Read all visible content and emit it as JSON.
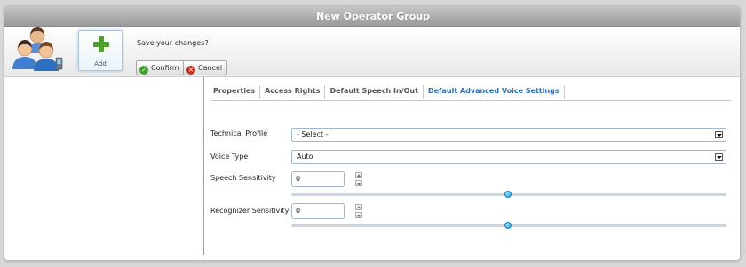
{
  "window": {
    "title": "New Operator Group"
  },
  "toolbar": {
    "group_icon": "user-group-icon",
    "add_label": "Add",
    "add_icon": "plus-icon",
    "prompt": "Save your changes?",
    "confirm_label": "Confirm",
    "confirm_icon": "check-icon",
    "cancel_label": "Cancel",
    "cancel_icon": "close-icon"
  },
  "tabs": [
    {
      "label": "Properties",
      "active": false
    },
    {
      "label": "Access Rights",
      "active": false
    },
    {
      "label": "Default Speech In/Out",
      "active": false
    },
    {
      "label": "Default Advanced Voice Settings",
      "active": true
    }
  ],
  "form": {
    "technical_profile": {
      "label": "Technical Profile",
      "value": "- Select -"
    },
    "voice_type": {
      "label": "Voice Type",
      "value": "Auto"
    },
    "speech_sensitivity": {
      "label": "Speech Sensitivity",
      "value": "0",
      "slider_level": 0.5
    },
    "recognizer_sensitivity": {
      "label": "Recognizer Sensitivity",
      "value": "0",
      "slider_level": 0.5
    }
  },
  "colors": {
    "active_tab": "#2a6db0",
    "confirm": "#3f9f2c",
    "cancel": "#c2301e",
    "slider_thumb": "#1d9ad6"
  }
}
